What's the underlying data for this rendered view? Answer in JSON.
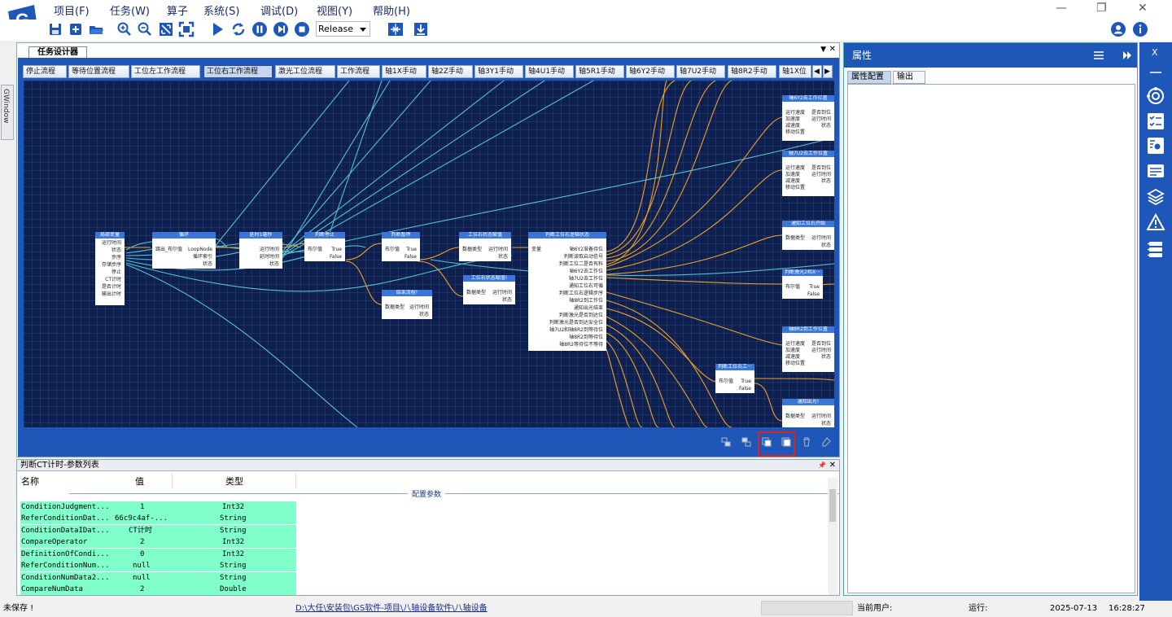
{
  "menu": {
    "items": [
      "项目(F)",
      "任务(W)",
      "算子",
      "系统(S)",
      "调试(D)",
      "视图(Y)",
      "帮助(H)"
    ],
    "window_controls": [
      "—",
      "❐",
      "✕"
    ]
  },
  "toolbar": {
    "icons": [
      "save-icon",
      "new-icon",
      "open-folder-icon",
      "zoom-in-icon",
      "zoom-out-icon",
      "fit-icon",
      "fullscreen-icon",
      "run-icon",
      "loop-icon",
      "pause-icon",
      "step-icon",
      "stop-icon",
      "align-icon",
      "download-icon"
    ],
    "build_config": "Release"
  },
  "left_strip": {
    "tab": "GWindow"
  },
  "designer": {
    "title": "任务设计器",
    "controls": [
      "▼",
      "✕"
    ],
    "tabs": [
      "停止流程",
      "等待位置流程",
      "工位左工作流程",
      "工位右工作流程",
      "激光工位流程",
      "工作流程",
      "轴1X手动",
      "轴2Z手动",
      "轴3Y1手动",
      "轴4U1手动",
      "轴5R1手动",
      "轴6Y2手动",
      "轴7U2手动",
      "轴8R2手动",
      "轴1X位"
    ],
    "active_tab": "工位右工作流程",
    "nav": [
      "◀",
      "▶"
    ],
    "nodes": {
      "n1": {
        "title": "局部变量",
        "left": [
          "运行时间",
          "状态",
          "步序",
          "存储步序",
          "停止",
          "CT计时",
          "是否计时",
          "输出计时"
        ],
        "right": []
      },
      "n2": {
        "title": "循环",
        "left": [
          "跳出_布尔值"
        ],
        "right": [
          "LoopNode",
          "循环索引",
          "状态"
        ]
      },
      "n3": {
        "title": "延时1毫秒",
        "left": [],
        "right": [
          "运行时间",
          "延时时间",
          "状态"
        ]
      },
      "n4": {
        "title": "判断停止",
        "left": [
          "布尔值"
        ],
        "right": [
          "True",
          "False"
        ]
      },
      "n5": {
        "title": "判断暂停",
        "left": [
          "布尔值"
        ],
        "right": [
          "True",
          "False"
        ]
      },
      "n6": {
        "title": "工位右状态赋值",
        "left": [
          "数据类型"
        ],
        "right": [
          "运行时间",
          "状态"
        ]
      },
      "n7": {
        "title": "结束流程!",
        "left": [
          "数据类型"
        ],
        "right": [
          "运行时间",
          "状态"
        ]
      },
      "n8": {
        "title": "工位右状态赋值!",
        "left": [
          "数据类型"
        ],
        "right": [
          "运行时间",
          "状态"
        ]
      },
      "n9": {
        "title": "判断工位右逻辑状态",
        "left": [
          "变量"
        ],
        "right": [
          "轴6Y2准备待位",
          "判断读取启动信号",
          "判断工位二是否有料",
          "轴6Y2去工作位",
          "轴7U2去工作位",
          "通知工位右可循",
          "判断工位右逻辑步序",
          "轴8R2到工作位",
          "通知出光结束",
          "判断激光是否到达位",
          "判断激光是否到达安全位",
          "轴7U2和轴8R2到等待位",
          "轴8R2到等待位",
          "轴8R2等待位不等待"
        ]
      },
      "n10": {
        "title": "轴6Y2去工作位置",
        "left": [
          "运行速度",
          "加速度",
          "减速度",
          "移动位置"
        ],
        "right": [
          "是否到位",
          "运行时间",
          "状态"
        ]
      },
      "n11": {
        "title": "轴7U2去工作位置",
        "left": [
          "运行速度",
          "加速度",
          "减速度",
          "移动位置"
        ],
        "right": [
          "是否到位",
          "运行时间",
          "状态"
        ]
      },
      "n12": {
        "title": "通知工位右开始",
        "left": [
          "数据类型"
        ],
        "right": [
          "运行时间",
          "状态"
        ]
      },
      "n13": {
        "title": "判断激光2和X···",
        "left": [
          "布尔值"
        ],
        "right": [
          "True",
          "False"
        ]
      },
      "n14": {
        "title": "轴8R2到工作位置",
        "left": [
          "运行速度",
          "加速度",
          "减速度",
          "移动位置"
        ],
        "right": [
          "是否到位",
          "运行时间",
          "状态"
        ]
      },
      "n15": {
        "title": "判断工位右工···",
        "left": [
          "布尔值"
        ],
        "right": [
          "True",
          "False"
        ]
      },
      "n16": {
        "title": "通知出光!",
        "left": [
          "数据类型"
        ],
        "right": [
          "运行时间",
          "状态"
        ]
      }
    },
    "bottom_icons": [
      "group-icon",
      "ungroup-icon",
      "copy-icon",
      "paste-icon",
      "delete-icon",
      "clear-icon"
    ]
  },
  "params": {
    "title": "判断CT计时-参数列表",
    "controls": [
      "📌",
      "✕"
    ],
    "columns": [
      "名称",
      "值",
      "类型"
    ],
    "group": "配置参数",
    "rows": [
      [
        "ConditionJudgment...",
        "1",
        "Int32"
      ],
      [
        "ReferConditionDat...",
        "66c9c4af-...",
        "String"
      ],
      [
        "ConditionDataIDat...",
        "CT计时",
        "String"
      ],
      [
        "CompareOperator",
        "2",
        "Int32"
      ],
      [
        "DefinitionOfCondi...",
        "0",
        "Int32"
      ],
      [
        "ReferConditionNum...",
        "null",
        "String"
      ],
      [
        "ConditionNumData2...",
        "null",
        "String"
      ],
      [
        "CompareNumData",
        "2",
        "Double"
      ]
    ]
  },
  "properties": {
    "title": "属性",
    "tabs": [
      "属性配置",
      "输出"
    ],
    "active_tab": "属性配置"
  },
  "right_bar": {
    "title": "X",
    "icons": [
      "dash-icon",
      "lifebuoy-icon",
      "checklist-icon",
      "settings-list-icon",
      "id-card-icon",
      "layers-icon",
      "warning-icon",
      "structure-icon"
    ]
  },
  "status": {
    "saved": "未保存 !",
    "path": "D:\\大任\\安装包\\GS软件-项目\\八轴设备软件\\八轴设备",
    "user_label": "当前用户:",
    "run_label": "运行:",
    "date": "2025-07-13",
    "time": "16:28:27"
  },
  "colors": {
    "accent": "#1e57b8",
    "canvas": "#0e2050",
    "node_header": "#3a76d6",
    "wire_orange": "#f0a020",
    "wire_cyan": "#5fd0e0",
    "param_row": "#80ffcc"
  }
}
